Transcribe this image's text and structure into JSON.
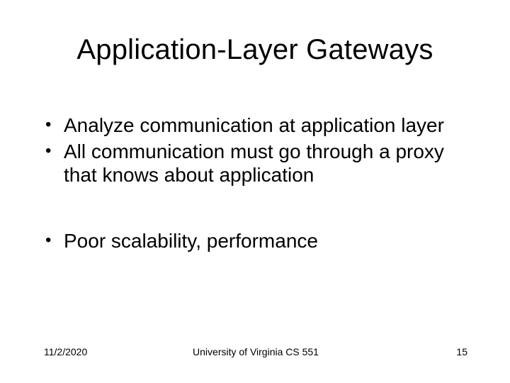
{
  "slide": {
    "title": "Application-Layer Gateways",
    "bullets_group1": [
      "Analyze communication at application layer",
      "All communication must go through a proxy that knows about application"
    ],
    "bullets_group2": [
      "Poor scalability, performance"
    ]
  },
  "footer": {
    "date": "11/2/2020",
    "center": "University of Virginia CS 551",
    "page": "15"
  }
}
